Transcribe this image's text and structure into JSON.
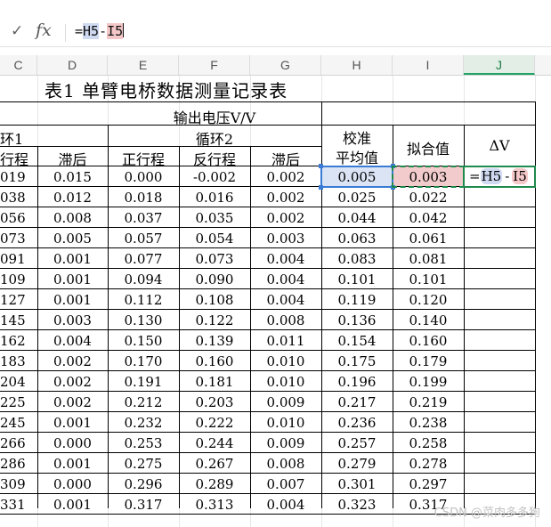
{
  "formula_bar": {
    "confirm_icon": "check-icon",
    "fx_label": "fx",
    "formula_prefix": "=",
    "formula_ref1": "H5",
    "formula_op": "-",
    "formula_ref2": "I5"
  },
  "columns": [
    "C",
    "D",
    "E",
    "F",
    "G",
    "H",
    "I",
    "J"
  ],
  "sheet": {
    "title": "表1  单臂电桥数据测量记录表",
    "output_header": "输出电压V/V",
    "cycle1_header": "环1",
    "cycle2_header": "循环2",
    "calib_header_line1": "校准",
    "calib_header_line2": "平均值",
    "fit_header": "拟合值",
    "delta_header": "ΔV",
    "sub_headers": [
      "行程",
      "滞后",
      "正行程",
      "反行程",
      "滞后"
    ],
    "editing_text": {
      "eq": "=",
      "ref1": "H5",
      "op": "-",
      "ref2": "I5"
    },
    "rows": [
      [
        "019",
        "0.015",
        "0.000",
        "-0.002",
        "0.002",
        "0.005",
        "0.003"
      ],
      [
        "038",
        "0.012",
        "0.018",
        "0.016",
        "0.002",
        "0.025",
        "0.022"
      ],
      [
        "056",
        "0.008",
        "0.037",
        "0.035",
        "0.002",
        "0.044",
        "0.042"
      ],
      [
        "073",
        "0.005",
        "0.057",
        "0.054",
        "0.003",
        "0.063",
        "0.061"
      ],
      [
        "091",
        "0.001",
        "0.077",
        "0.073",
        "0.004",
        "0.083",
        "0.081"
      ],
      [
        "109",
        "0.001",
        "0.094",
        "0.090",
        "0.004",
        "0.101",
        "0.101"
      ],
      [
        "127",
        "0.001",
        "0.112",
        "0.108",
        "0.004",
        "0.119",
        "0.120"
      ],
      [
        "145",
        "0.003",
        "0.130",
        "0.122",
        "0.008",
        "0.136",
        "0.140"
      ],
      [
        "162",
        "0.004",
        "0.150",
        "0.139",
        "0.011",
        "0.154",
        "0.160"
      ],
      [
        "183",
        "0.002",
        "0.170",
        "0.160",
        "0.010",
        "0.175",
        "0.179"
      ],
      [
        "204",
        "0.002",
        "0.191",
        "0.181",
        "0.010",
        "0.196",
        "0.199"
      ],
      [
        "225",
        "0.002",
        "0.212",
        "0.203",
        "0.009",
        "0.217",
        "0.219"
      ],
      [
        "245",
        "0.001",
        "0.232",
        "0.222",
        "0.010",
        "0.236",
        "0.238"
      ],
      [
        "266",
        "0.000",
        "0.253",
        "0.244",
        "0.009",
        "0.257",
        "0.258"
      ],
      [
        "286",
        "0.001",
        "0.275",
        "0.267",
        "0.008",
        "0.279",
        "0.278"
      ],
      [
        "309",
        "0.000",
        "0.296",
        "0.289",
        "0.007",
        "0.301",
        "0.297"
      ],
      [
        "331",
        "0.001",
        "0.317",
        "0.313",
        "0.004",
        "0.323",
        "0.317"
      ]
    ]
  },
  "watermark": "CSDN @菜肉多多狗",
  "colors": {
    "selected_col": "#21a366",
    "ref1": "#cfdaf2",
    "ref2": "#f2cccc"
  }
}
